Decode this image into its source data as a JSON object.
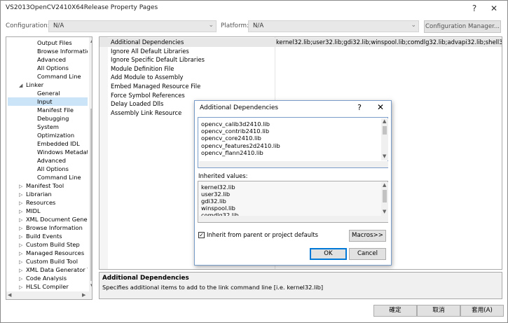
{
  "window": {
    "title": "VS2013OpenCV2410X64Release Property Pages",
    "help": "?",
    "close": "✕"
  },
  "config": {
    "configuration_label": "Configuration:",
    "configuration_value": "N/A",
    "platform_label": "Platform:",
    "platform_value": "N/A",
    "manager_label": "Configuration Manager..."
  },
  "tree": {
    "items": [
      {
        "label": "Output Files",
        "level": 2,
        "arrow": ""
      },
      {
        "label": "Browse Informatio",
        "level": 2,
        "arrow": ""
      },
      {
        "label": "Advanced",
        "level": 2,
        "arrow": ""
      },
      {
        "label": "All Options",
        "level": 2,
        "arrow": ""
      },
      {
        "label": "Command Line",
        "level": 2,
        "arrow": ""
      },
      {
        "label": "Linker",
        "level": 1,
        "arrow": "◢"
      },
      {
        "label": "General",
        "level": 2,
        "arrow": ""
      },
      {
        "label": "Input",
        "level": 2,
        "arrow": "",
        "selected": true
      },
      {
        "label": "Manifest File",
        "level": 2,
        "arrow": ""
      },
      {
        "label": "Debugging",
        "level": 2,
        "arrow": ""
      },
      {
        "label": "System",
        "level": 2,
        "arrow": ""
      },
      {
        "label": "Optimization",
        "level": 2,
        "arrow": ""
      },
      {
        "label": "Embedded IDL",
        "level": 2,
        "arrow": ""
      },
      {
        "label": "Windows Metadat",
        "level": 2,
        "arrow": ""
      },
      {
        "label": "Advanced",
        "level": 2,
        "arrow": ""
      },
      {
        "label": "All Options",
        "level": 2,
        "arrow": ""
      },
      {
        "label": "Command Line",
        "level": 2,
        "arrow": ""
      },
      {
        "label": "Manifest Tool",
        "level": 1,
        "arrow": "▷"
      },
      {
        "label": "Librarian",
        "level": 1,
        "arrow": "▷"
      },
      {
        "label": "Resources",
        "level": 1,
        "arrow": "▷"
      },
      {
        "label": "MIDL",
        "level": 1,
        "arrow": "▷"
      },
      {
        "label": "XML Document Gene",
        "level": 1,
        "arrow": "▷"
      },
      {
        "label": "Browse Information",
        "level": 1,
        "arrow": "▷"
      },
      {
        "label": "Build Events",
        "level": 1,
        "arrow": "▷"
      },
      {
        "label": "Custom Build Step",
        "level": 1,
        "arrow": "▷"
      },
      {
        "label": "Managed Resources",
        "level": 1,
        "arrow": "▷"
      },
      {
        "label": "Custom Build Tool",
        "level": 1,
        "arrow": "▷"
      },
      {
        "label": "XML Data Generator T",
        "level": 1,
        "arrow": "▷"
      },
      {
        "label": "Code Analysis",
        "level": 1,
        "arrow": "▷"
      },
      {
        "label": "HLSL Compiler",
        "level": 1,
        "arrow": "▷"
      }
    ]
  },
  "props": {
    "rows": [
      {
        "name": "Additional Dependencies",
        "value": "kernel32.lib;user32.lib;gdi32.lib;winspool.lib;comdlg32.lib;advapi32.lib;shell32.lib;ole",
        "selected": true
      },
      {
        "name": "Ignore All Default Libraries",
        "value": ""
      },
      {
        "name": "Ignore Specific Default Libraries",
        "value": ""
      },
      {
        "name": "Module Definition File",
        "value": ""
      },
      {
        "name": "Add Module to Assembly",
        "value": ""
      },
      {
        "name": "Embed Managed Resource File",
        "value": ""
      },
      {
        "name": "Force Symbol References",
        "value": ""
      },
      {
        "name": "Delay Loaded Dlls",
        "value": ""
      },
      {
        "name": "Assembly Link Resource",
        "value": ""
      }
    ]
  },
  "description": {
    "title": "Additional Dependencies",
    "text": "Specifies additional items to add to the link command line [i.e. kernel32.lib]"
  },
  "buttons": {
    "ok": "確定",
    "cancel": "取消",
    "apply": "套用(A)"
  },
  "dialog": {
    "title": "Additional Dependencies",
    "help": "?",
    "close": "✕",
    "entries": [
      "opencv_calib3d2410.lib",
      "opencv_contrib2410.lib",
      "opencv_core2410.lib",
      "opencv_features2d2410.lib",
      " opencv_flann2410.lib"
    ],
    "inherited_label": "Inherited values:",
    "inherited": [
      "kernel32.lib",
      "user32.lib",
      "gdi32.lib",
      "winspool.lib",
      "comdlg32.lib"
    ],
    "inherit_checkbox_label": "Inherit from parent or project defaults",
    "inherit_checked": true,
    "macros_label": "Macros>>",
    "ok_label": "OK",
    "cancel_label": "Cancel"
  }
}
